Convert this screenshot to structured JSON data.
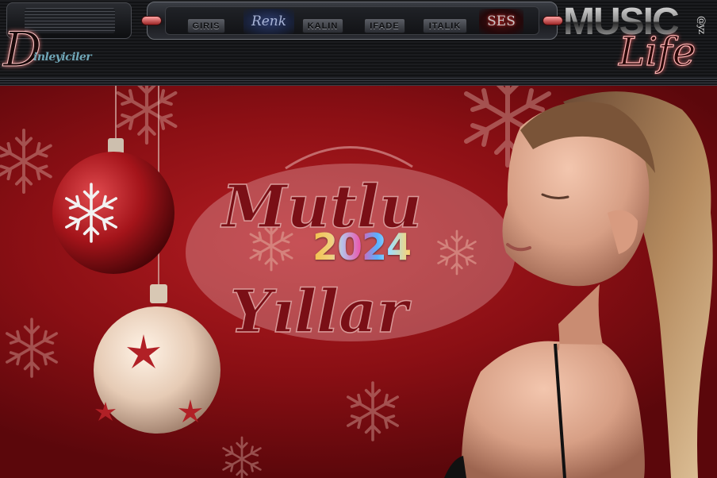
{
  "header": {
    "menu": [
      {
        "key": "giris",
        "label": "GIRIS"
      },
      {
        "key": "renk",
        "label": "Renk"
      },
      {
        "key": "kalin",
        "label": "KALIN"
      },
      {
        "key": "ifade",
        "label": "IFADE"
      },
      {
        "key": "italik",
        "label": "ITALIK"
      },
      {
        "key": "ses",
        "label": "SES"
      }
    ],
    "brand_left_initial": "D",
    "brand_left_rest": "inleyiciler",
    "brand_right_top": "MUSIC",
    "brand_right_suffix": "@yz",
    "brand_right_script": "Life"
  },
  "banner": {
    "greeting_line1": "Mutlu",
    "greeting_line2": "Yıllar",
    "year": "2024"
  },
  "colors": {
    "background_red": "#8a0f14",
    "accent_pink": "#ffb3b3",
    "accent_teal": "#6fa6b7"
  },
  "icons": [
    "ornament-icon",
    "snowflake-icon",
    "star-icon",
    "slider-knob-icon"
  ]
}
